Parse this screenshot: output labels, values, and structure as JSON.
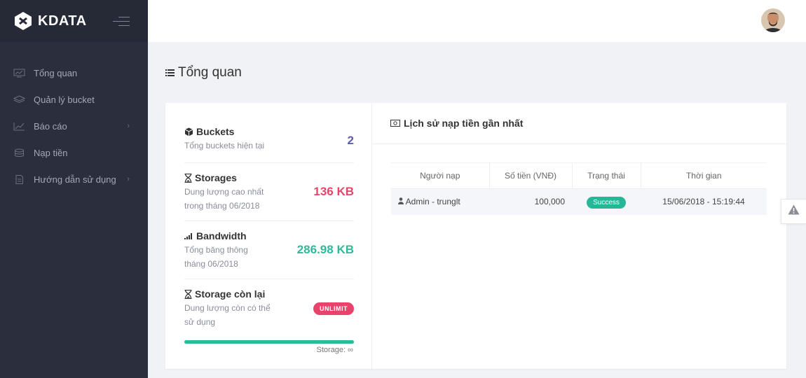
{
  "brand": {
    "name": "KDATA"
  },
  "sidebar": {
    "items": [
      {
        "label": "Tổng quan",
        "icon": "monitor-icon",
        "has_children": false
      },
      {
        "label": "Quản lý bucket",
        "icon": "layers-icon",
        "has_children": false
      },
      {
        "label": "Báo cáo",
        "icon": "chart-line-icon",
        "has_children": true
      },
      {
        "label": "Nạp tiền",
        "icon": "coins-icon",
        "has_children": false
      },
      {
        "label": "Hướng dẫn sử dụng",
        "icon": "document-icon",
        "has_children": true
      }
    ]
  },
  "page": {
    "title": "Tổng quan"
  },
  "stats": {
    "buckets": {
      "title": "Buckets",
      "subtitle": "Tổng buckets hiện tại",
      "value": "2",
      "color": "#5d5fa8"
    },
    "storages": {
      "title": "Storages",
      "subtitle_line1": "Dung lượng cao nhất",
      "subtitle_line2": "trong tháng 06/2018",
      "value": "136 KB",
      "color": "#e8436b"
    },
    "bandwidth": {
      "title": "Bandwidth",
      "subtitle_line1": "Tổng băng thông",
      "subtitle_line2": "tháng 06/2018",
      "value": "286.98 KB",
      "color": "#2fb99b"
    },
    "remaining": {
      "title": "Storage còn lại",
      "subtitle_line1": "Dung lượng còn có thể",
      "subtitle_line2": "sử dụng",
      "badge": "UNLIMIT",
      "progress_percent": 100,
      "note": "Storage: ∞"
    }
  },
  "history": {
    "title": "Lịch sử nạp tiền gần nhất",
    "columns": [
      "Người nạp",
      "Số tiền (VNĐ)",
      "Trạng thái",
      "Thời gian"
    ],
    "rows": [
      {
        "user": "Admin - trunglt",
        "amount": "100,000",
        "status": "Success",
        "time": "15/06/2018 - 15:19:44"
      }
    ]
  },
  "colors": {
    "sidebar": "#2b2e3c",
    "accent_green": "#2fb99b",
    "accent_red": "#e8436b"
  }
}
